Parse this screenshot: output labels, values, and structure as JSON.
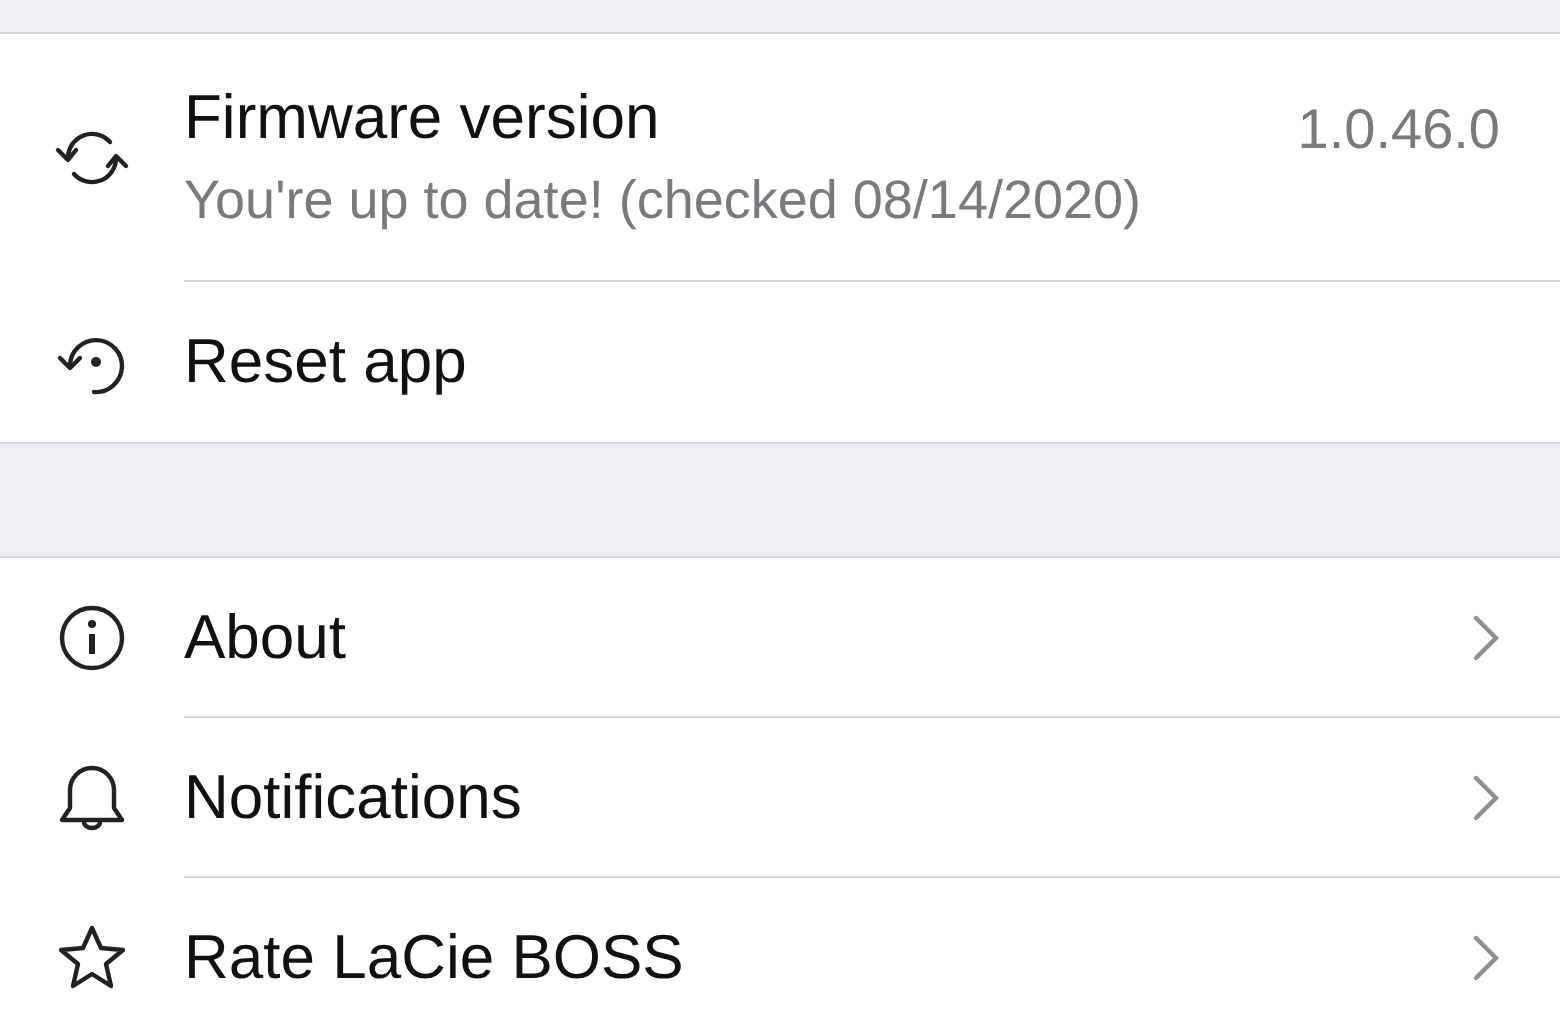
{
  "sections": [
    {
      "rows": [
        {
          "kind": "firmware",
          "title": "Firmware version",
          "subtitle": "You're up to date! (checked 08/14/2020)",
          "value": "1.0.46.0",
          "chevron": false
        },
        {
          "kind": "plain",
          "title": "Reset app",
          "chevron": false
        }
      ]
    },
    {
      "rows": [
        {
          "kind": "plain",
          "title": "About",
          "chevron": true
        },
        {
          "kind": "plain",
          "title": "Notifications",
          "chevron": true
        },
        {
          "kind": "plain",
          "title": "Rate LaCie BOSS",
          "chevron": true
        }
      ]
    }
  ]
}
